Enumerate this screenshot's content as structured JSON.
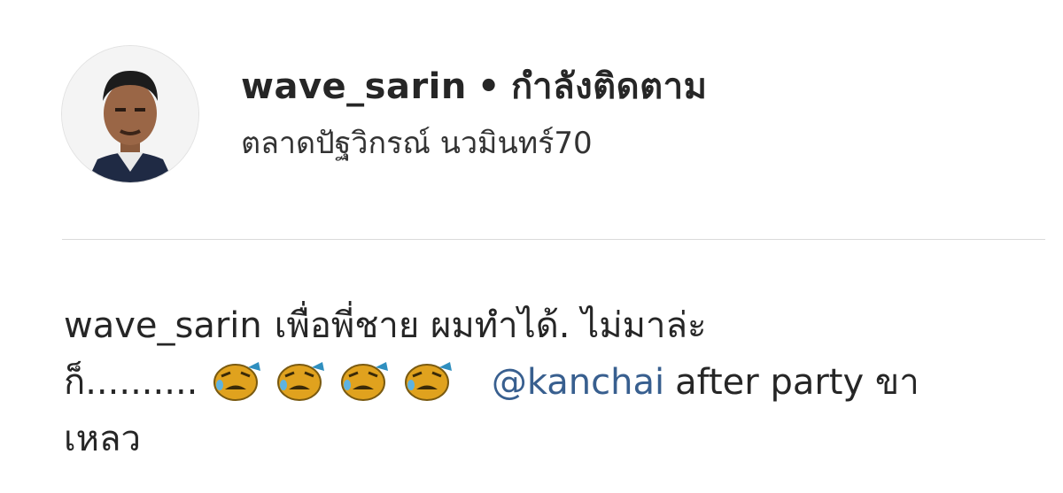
{
  "post_header": {
    "username": "wave_sarin",
    "separator": "•",
    "follow_status": "กำลังติดตาม",
    "location": "ตลาดปัฐวิกรณ์ นวมินทร์70"
  },
  "comment": {
    "username": "wave_sarin",
    "line1_text": "เพื่อพี่ชาย ผมทำได้. ไม่มาล่ะ",
    "line2_prefix": "ก็..........",
    "emoji_name": "weary-face-icon",
    "emoji_count": 4,
    "mention": "@kanchai",
    "line2_suffix": "after party ขา",
    "line3_text": "เหลว"
  },
  "colors": {
    "mention": "#385f8f",
    "divider": "#dbdbdb",
    "text": "#262626"
  }
}
